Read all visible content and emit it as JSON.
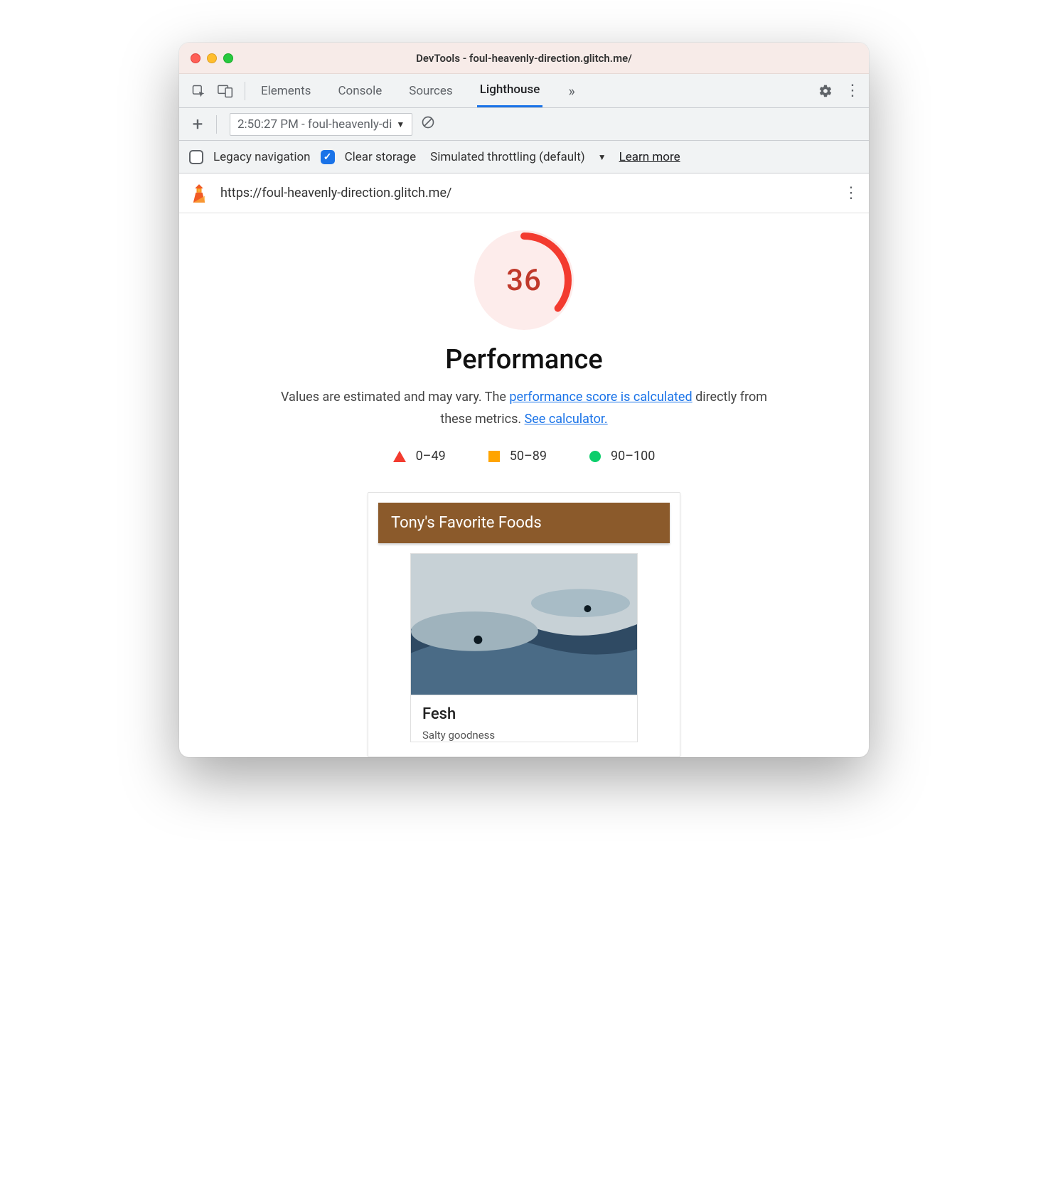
{
  "window": {
    "title": "DevTools - foul-heavenly-direction.glitch.me/"
  },
  "tabs": {
    "items": [
      "Elements",
      "Console",
      "Sources",
      "Lighthouse"
    ],
    "active": "Lighthouse"
  },
  "reportSelect": {
    "label": "2:50:27 PM - foul-heavenly-di"
  },
  "settings": {
    "legacy_label": "Legacy navigation",
    "legacy_checked": false,
    "clear_label": "Clear storage",
    "clear_checked": true,
    "throttle_label": "Simulated throttling (default)",
    "learn_more": "Learn more"
  },
  "url": "https://foul-heavenly-direction.glitch.me/",
  "score": {
    "value": "36",
    "percent": 36,
    "color": "#f33b2f",
    "title": "Performance",
    "desc_pre": "Values are estimated and may vary. The ",
    "desc_link1": "performance score is calculated",
    "desc_mid": " directly from these metrics. ",
    "desc_link2": "See calculator."
  },
  "legend": {
    "bad": "0–49",
    "mid": "50–89",
    "good": "90–100"
  },
  "card": {
    "header": "Tony's Favorite Foods",
    "item_title": "Fesh",
    "item_sub": "Salty goodness"
  }
}
